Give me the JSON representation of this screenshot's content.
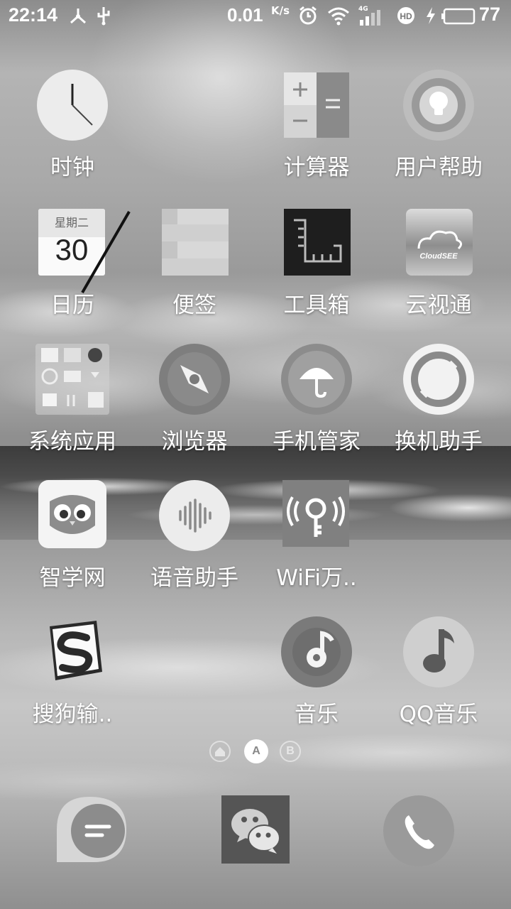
{
  "status_bar": {
    "time": "22:14",
    "net_speed": "0.01",
    "net_speed_unit": "K/s",
    "network": "4G",
    "battery": "77",
    "icons": [
      "usb-share-icon",
      "usb-icon",
      "alarm-icon",
      "wifi-icon",
      "signal-icon",
      "hd-icon",
      "charging-icon",
      "battery-icon"
    ]
  },
  "apps": {
    "clock": "时钟",
    "calculator": "计算器",
    "user_help": "用户帮助",
    "calendar": "日历",
    "calendar_weekday": "星期二",
    "calendar_day": "30",
    "notes": "便签",
    "toolbox": "工具箱",
    "cloudsee": "云视通",
    "cloudsee_logo_text": "CloudSEE",
    "system_apps": "系统应用",
    "browser": "浏览器",
    "phone_manager": "手机管家",
    "phone_migration": "换机助手",
    "zhixue": "智学网",
    "voice_assistant": "语音助手",
    "wifi_master": "WiFi万..",
    "sogou_input": "搜狗输..",
    "music": "音乐",
    "qq_music": "QQ音乐"
  },
  "page_indicator": {
    "pages": [
      "home",
      "A",
      "B"
    ],
    "current": "A"
  },
  "dock": {
    "items": [
      "messages",
      "wechat",
      "phone"
    ]
  }
}
